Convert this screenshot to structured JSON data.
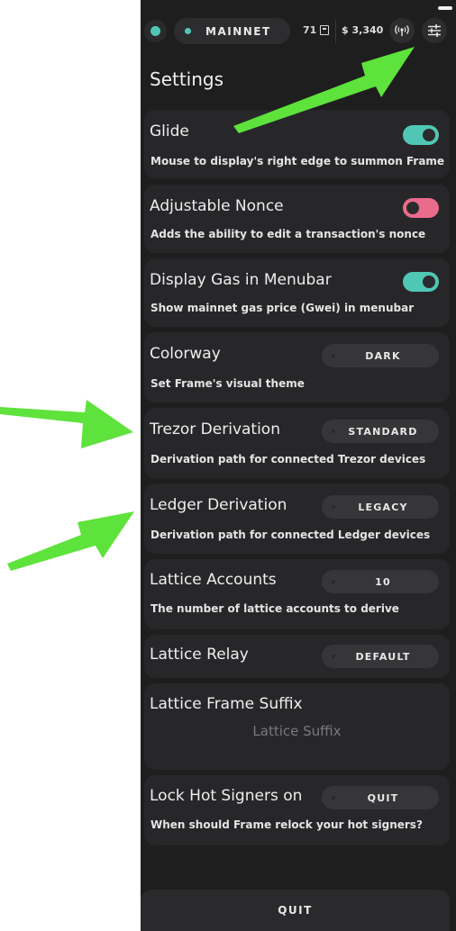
{
  "topbar": {
    "network": "MAINNET",
    "gas": "71",
    "price": "$ 3,340"
  },
  "page_title": "Settings",
  "settings": [
    {
      "title": "Glide",
      "desc": "Mouse to display's right edge to summon Frame",
      "state": "on"
    },
    {
      "title": "Adjustable Nonce",
      "desc": "Adds the ability to edit a transaction's nonce",
      "state": "off"
    },
    {
      "title": "Display Gas in Menubar",
      "desc": "Show mainnet gas price (Gwei) in menubar",
      "state": "on"
    },
    {
      "title": "Colorway",
      "desc": "Set Frame's visual theme",
      "value": "DARK"
    },
    {
      "title": "Trezor Derivation",
      "desc": "Derivation path for connected Trezor devices",
      "value": "STANDARD"
    },
    {
      "title": "Ledger Derivation",
      "desc": "Derivation path for connected Ledger devices",
      "value": "LEGACY"
    },
    {
      "title": "Lattice Accounts",
      "desc": "The number of lattice accounts to derive",
      "value": "10"
    },
    {
      "title": "Lattice Relay",
      "value": "DEFAULT"
    },
    {
      "title": "Lattice Frame Suffix",
      "placeholder": "Lattice Suffix"
    },
    {
      "title": "Lock Hot Signers on",
      "desc": "When should Frame relock your hot signers?",
      "value": "QUIT"
    }
  ],
  "footer": {
    "quit_label": "QUIT"
  },
  "colors": {
    "panel": "#1e1e1f",
    "card": "#27272a",
    "toggle_on": "#4fc7b4",
    "toggle_off": "#ea6b8c",
    "annotation_arrow": "#5ee23c"
  },
  "icons": [
    "status-dot-icon",
    "gas-pump-icon",
    "signal-icon",
    "settings-sliders-icon",
    "annotation-arrow-icon"
  ]
}
